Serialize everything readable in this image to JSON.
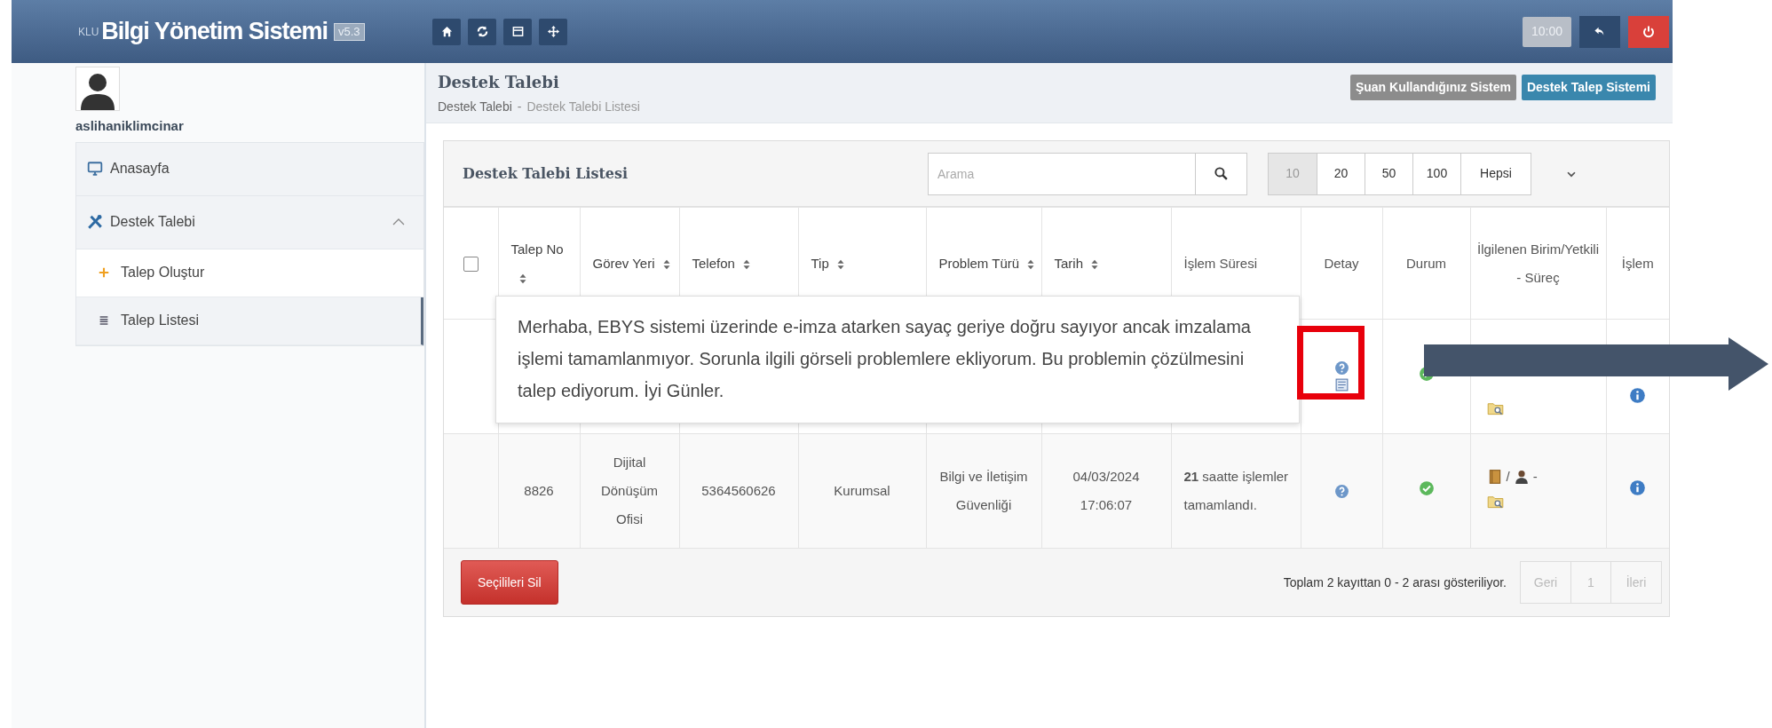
{
  "navbar": {
    "logo_prefix": "KLU",
    "title": "Bilgi Yönetim Sistemi",
    "version": "v5.3",
    "clock": "10:00"
  },
  "sidebar": {
    "username": "aslihaniklimcinar",
    "items": [
      {
        "label": "Anasayfa"
      },
      {
        "label": "Destek Talebi",
        "expanded": true,
        "children": [
          {
            "label": "Talep Oluştur",
            "selected": false,
            "hovered": true
          },
          {
            "label": "Talep Listesi",
            "selected": true,
            "hovered": false
          }
        ]
      }
    ]
  },
  "page": {
    "title": "Destek Talebi",
    "breadcrumb": [
      "Destek Talebi",
      "Destek Talebi Listesi"
    ],
    "breadcrumb_separator": "-",
    "badges": [
      {
        "label": "Şuan Kullandığınız Sistem",
        "color": "#8c8c8c"
      },
      {
        "label": "Destek Talep Sistemi",
        "color": "#3a87ad"
      }
    ]
  },
  "panel": {
    "title": "Destek Talebi Listesi",
    "search": {
      "placeholder": "Arama"
    },
    "page_sizes": [
      {
        "label": "10",
        "selected": true
      },
      {
        "label": "20",
        "selected": false
      },
      {
        "label": "50",
        "selected": false
      },
      {
        "label": "100",
        "selected": false
      },
      {
        "label": "Hepsi",
        "selected": false
      }
    ],
    "select_all": {
      "checked": false
    },
    "columns": [
      {
        "label": "Talep No",
        "sortable": true
      },
      {
        "label": "Görev Yeri",
        "sortable": true
      },
      {
        "label": "Telefon",
        "sortable": true
      },
      {
        "label": "Tip",
        "sortable": true
      },
      {
        "label": "Problem Türü",
        "sortable": true
      },
      {
        "label": "Tarih",
        "sortable": true
      },
      {
        "label": "İşlem Süresi",
        "sortable": false
      },
      {
        "label": "Detay",
        "sortable": false
      },
      {
        "label": "Durum",
        "sortable": false
      },
      {
        "label": "İlgilenen Birim/Yetkili - Süreç",
        "sortable": false
      },
      {
        "label": "İşlem",
        "sortable": false
      }
    ],
    "rows": [
      {
        "attachment": true
      },
      {
        "attachment": false,
        "talep_no": "8826",
        "gorev_yeri": "Dijital Dönüşüm Ofisi",
        "telefon": "5364560626",
        "tip": "Kurumsal",
        "problem_turu": "Bilgi ve İletişim Güvenliği",
        "tarih": "04/03/2024 17:06:07",
        "islem_suresi": "**21** saatte işlemler tamamlandı.",
        "handler_separator": "/",
        "handler_dash": "-"
      }
    ],
    "tooltip": {
      "text": "Merhaba, EBYS sistemi üzerinde e-imza atarken sayaç geriye doğru sayıyor ancak imzalama işlemi tamamlanmıyor. Sorunla ilgili görseli problemlere ekliyorum. Bu problemin çözülmesini talep ediyorum. İyi Günler."
    },
    "footer": {
      "delete_button": "Seçilileri Sil",
      "summary": "Toplam 2 kayıttan 0 - 2 arası gösteriliyor.",
      "pagination": [
        {
          "label": "Geri",
          "disabled": true
        },
        {
          "label": "1",
          "disabled": true
        },
        {
          "label": "İleri",
          "disabled": true
        }
      ]
    }
  }
}
